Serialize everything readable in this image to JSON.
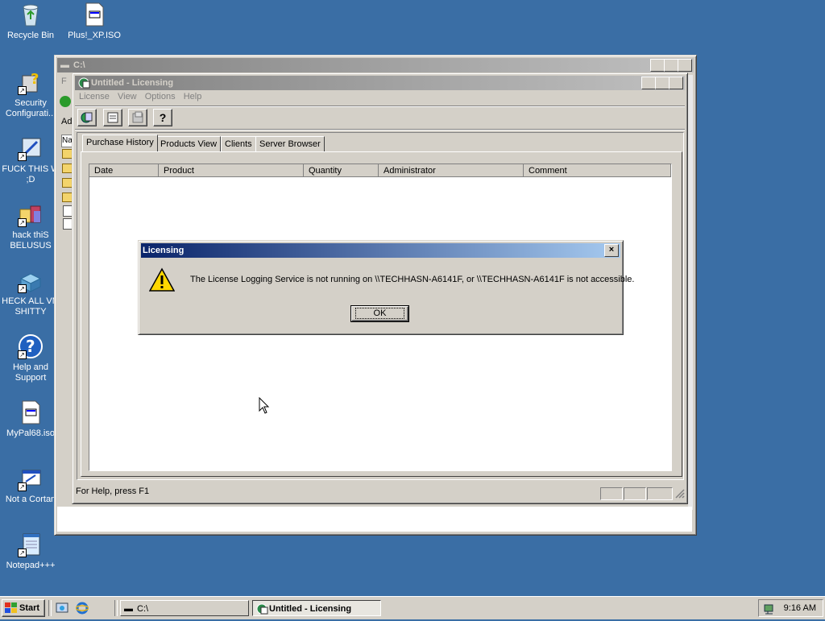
{
  "desktop": {
    "icons": [
      {
        "label": "Recycle Bin",
        "icon": "recycle-bin-icon"
      },
      {
        "label": "Plus!_XP.ISO",
        "icon": "iso-file-icon"
      },
      {
        "label": "Security\nConfigurati...",
        "icon": "security-config-icon"
      },
      {
        "label": "FUCK THIS W\n;D",
        "icon": "shortcut-app-icon"
      },
      {
        "label": "hack thiS\nBELUSUS",
        "icon": "folder-shortcut-icon"
      },
      {
        "label": "HECK ALL VM\nSHITTY",
        "icon": "blocks-app-icon"
      },
      {
        "label": "Help and\nSupport",
        "icon": "help-icon"
      },
      {
        "label": "MyPal68.iso",
        "icon": "iso-file-icon"
      },
      {
        "label": "Not a Cortan",
        "icon": "shortcut-window-icon"
      },
      {
        "label": "Notepad+++",
        "icon": "notepad-icon"
      }
    ]
  },
  "explorer": {
    "title": "C:\\",
    "address_label": "Ad",
    "menu_first": "F",
    "column_first": "Na"
  },
  "licensing": {
    "title": "Untitled - Licensing",
    "menu": [
      "License",
      "View",
      "Options",
      "Help"
    ],
    "toolbar_icons": [
      "server-connect-icon",
      "properties-icon",
      "new-license-icon",
      "help-icon"
    ],
    "tabs": [
      "Purchase History",
      "Products View",
      "Clients",
      "Server Browser"
    ],
    "active_tab": "Purchase History",
    "columns": [
      "Date",
      "Product",
      "Quantity",
      "Administrator",
      "Comment"
    ],
    "rows": [],
    "status": "For Help, press F1"
  },
  "dialog": {
    "title": "Licensing",
    "message": "The License Logging Service is not running on \\\\TECHHASN-A6141F, or \\\\TECHHASN-A6141F is not accessible.",
    "ok_label": "OK",
    "icon": "warning-icon"
  },
  "taskbar": {
    "start_label": "Start",
    "quick_launch": [
      "show-desktop-icon",
      "internet-explorer-icon"
    ],
    "tasks": [
      {
        "label": "C:\\",
        "active": false
      },
      {
        "label": "Untitled - Licensing",
        "active": true
      }
    ],
    "clock": "9:16 AM"
  },
  "colors": {
    "desktop": "#3a6ea5",
    "face": "#d4d0c8",
    "active_title_start": "#0a246a",
    "active_title_end": "#a6caf0"
  }
}
